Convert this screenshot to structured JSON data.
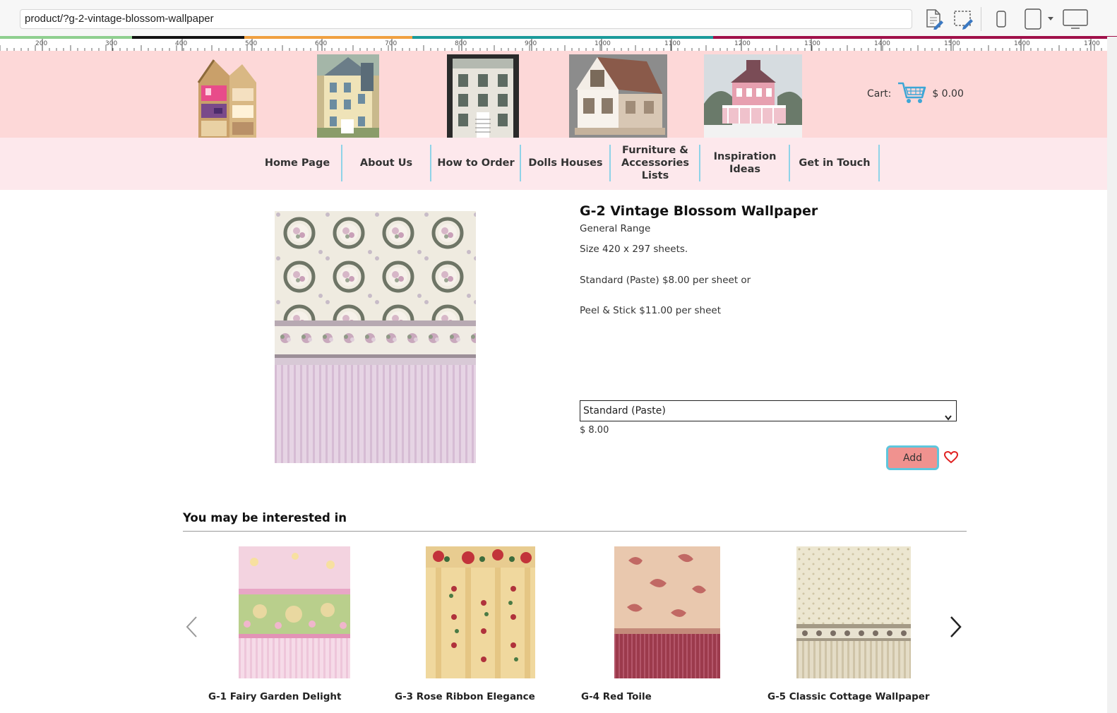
{
  "toolbar": {
    "url": "product/?g-2-vintage-blossom-wallpaper",
    "icons": [
      "edit-page-icon",
      "select-region-icon",
      "mobile-view-icon",
      "tablet-view-icon",
      "dropdown-icon",
      "desktop-view-icon"
    ]
  },
  "ruler": {
    "labels": [
      "200",
      "300",
      "400",
      "500",
      "600",
      "700",
      "800",
      "900",
      "1000",
      "1100",
      "1200",
      "1300",
      "1400",
      "1500",
      "1600",
      "1700"
    ]
  },
  "colors": {
    "header_bg": "#fdd8d8",
    "nav_bg": "#fde8ec",
    "nav_divider": "#8fd3e8",
    "add_button": "#f0928f",
    "add_button_border": "#5ec6dd",
    "cart_icon": "#3da6d6",
    "heart": "#e02020"
  },
  "header": {
    "house_images": [
      "dollhouse-open-front",
      "victorian-yellow-house",
      "white-townhouse",
      "wooden-kit-cottage",
      "pink-victorian-mansion"
    ],
    "cart_label": "Cart:",
    "cart_total": "$ 0.00"
  },
  "nav": {
    "items": [
      {
        "label": "Home Page"
      },
      {
        "label": "About Us"
      },
      {
        "label": "How to Order"
      },
      {
        "label": "Dolls Houses"
      },
      {
        "label": "Furniture & Accessories Lists"
      },
      {
        "label": "Inspiration Ideas"
      },
      {
        "label": "Get in Touch"
      }
    ]
  },
  "product": {
    "title": "G-2 Vintage Blossom Wallpaper",
    "range": "General Range",
    "desc1": "Size 420 x 297 sheets.",
    "desc2": "Standard (Paste) $8.00 per sheet or",
    "desc3": "Peel & Stick $11.00 per sheet",
    "selected_option": "Standard (Paste)",
    "price": "$ 8.00",
    "add_label": "Add"
  },
  "related": {
    "title": "You may be interested in",
    "items": [
      {
        "name": "G-1 Fairy Garden Delight"
      },
      {
        "name": "G-3 Rose Ribbon Elegance"
      },
      {
        "name": "G-4 Red Toile"
      },
      {
        "name": "G-5 Classic Cottage Wallpaper"
      }
    ]
  }
}
